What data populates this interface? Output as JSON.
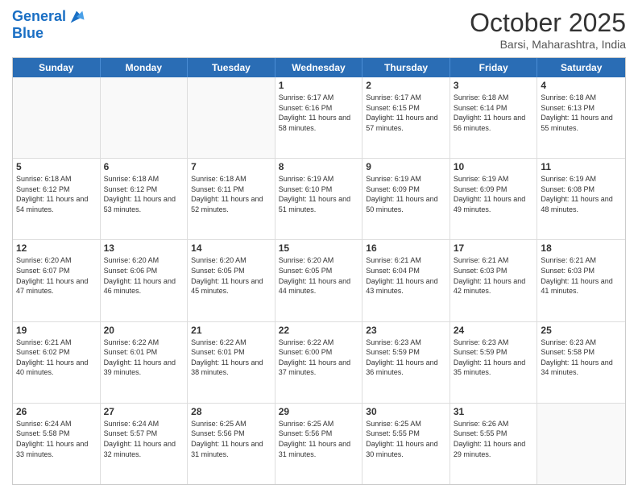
{
  "header": {
    "logo_line1": "General",
    "logo_line2": "Blue",
    "month": "October 2025",
    "location": "Barsi, Maharashtra, India"
  },
  "days_of_week": [
    "Sunday",
    "Monday",
    "Tuesday",
    "Wednesday",
    "Thursday",
    "Friday",
    "Saturday"
  ],
  "weeks": [
    [
      {
        "day": "",
        "info": ""
      },
      {
        "day": "",
        "info": ""
      },
      {
        "day": "",
        "info": ""
      },
      {
        "day": "1",
        "info": "Sunrise: 6:17 AM\nSunset: 6:16 PM\nDaylight: 11 hours and 58 minutes."
      },
      {
        "day": "2",
        "info": "Sunrise: 6:17 AM\nSunset: 6:15 PM\nDaylight: 11 hours and 57 minutes."
      },
      {
        "day": "3",
        "info": "Sunrise: 6:18 AM\nSunset: 6:14 PM\nDaylight: 11 hours and 56 minutes."
      },
      {
        "day": "4",
        "info": "Sunrise: 6:18 AM\nSunset: 6:13 PM\nDaylight: 11 hours and 55 minutes."
      }
    ],
    [
      {
        "day": "5",
        "info": "Sunrise: 6:18 AM\nSunset: 6:12 PM\nDaylight: 11 hours and 54 minutes."
      },
      {
        "day": "6",
        "info": "Sunrise: 6:18 AM\nSunset: 6:12 PM\nDaylight: 11 hours and 53 minutes."
      },
      {
        "day": "7",
        "info": "Sunrise: 6:18 AM\nSunset: 6:11 PM\nDaylight: 11 hours and 52 minutes."
      },
      {
        "day": "8",
        "info": "Sunrise: 6:19 AM\nSunset: 6:10 PM\nDaylight: 11 hours and 51 minutes."
      },
      {
        "day": "9",
        "info": "Sunrise: 6:19 AM\nSunset: 6:09 PM\nDaylight: 11 hours and 50 minutes."
      },
      {
        "day": "10",
        "info": "Sunrise: 6:19 AM\nSunset: 6:09 PM\nDaylight: 11 hours and 49 minutes."
      },
      {
        "day": "11",
        "info": "Sunrise: 6:19 AM\nSunset: 6:08 PM\nDaylight: 11 hours and 48 minutes."
      }
    ],
    [
      {
        "day": "12",
        "info": "Sunrise: 6:20 AM\nSunset: 6:07 PM\nDaylight: 11 hours and 47 minutes."
      },
      {
        "day": "13",
        "info": "Sunrise: 6:20 AM\nSunset: 6:06 PM\nDaylight: 11 hours and 46 minutes."
      },
      {
        "day": "14",
        "info": "Sunrise: 6:20 AM\nSunset: 6:05 PM\nDaylight: 11 hours and 45 minutes."
      },
      {
        "day": "15",
        "info": "Sunrise: 6:20 AM\nSunset: 6:05 PM\nDaylight: 11 hours and 44 minutes."
      },
      {
        "day": "16",
        "info": "Sunrise: 6:21 AM\nSunset: 6:04 PM\nDaylight: 11 hours and 43 minutes."
      },
      {
        "day": "17",
        "info": "Sunrise: 6:21 AM\nSunset: 6:03 PM\nDaylight: 11 hours and 42 minutes."
      },
      {
        "day": "18",
        "info": "Sunrise: 6:21 AM\nSunset: 6:03 PM\nDaylight: 11 hours and 41 minutes."
      }
    ],
    [
      {
        "day": "19",
        "info": "Sunrise: 6:21 AM\nSunset: 6:02 PM\nDaylight: 11 hours and 40 minutes."
      },
      {
        "day": "20",
        "info": "Sunrise: 6:22 AM\nSunset: 6:01 PM\nDaylight: 11 hours and 39 minutes."
      },
      {
        "day": "21",
        "info": "Sunrise: 6:22 AM\nSunset: 6:01 PM\nDaylight: 11 hours and 38 minutes."
      },
      {
        "day": "22",
        "info": "Sunrise: 6:22 AM\nSunset: 6:00 PM\nDaylight: 11 hours and 37 minutes."
      },
      {
        "day": "23",
        "info": "Sunrise: 6:23 AM\nSunset: 5:59 PM\nDaylight: 11 hours and 36 minutes."
      },
      {
        "day": "24",
        "info": "Sunrise: 6:23 AM\nSunset: 5:59 PM\nDaylight: 11 hours and 35 minutes."
      },
      {
        "day": "25",
        "info": "Sunrise: 6:23 AM\nSunset: 5:58 PM\nDaylight: 11 hours and 34 minutes."
      }
    ],
    [
      {
        "day": "26",
        "info": "Sunrise: 6:24 AM\nSunset: 5:58 PM\nDaylight: 11 hours and 33 minutes."
      },
      {
        "day": "27",
        "info": "Sunrise: 6:24 AM\nSunset: 5:57 PM\nDaylight: 11 hours and 32 minutes."
      },
      {
        "day": "28",
        "info": "Sunrise: 6:25 AM\nSunset: 5:56 PM\nDaylight: 11 hours and 31 minutes."
      },
      {
        "day": "29",
        "info": "Sunrise: 6:25 AM\nSunset: 5:56 PM\nDaylight: 11 hours and 31 minutes."
      },
      {
        "day": "30",
        "info": "Sunrise: 6:25 AM\nSunset: 5:55 PM\nDaylight: 11 hours and 30 minutes."
      },
      {
        "day": "31",
        "info": "Sunrise: 6:26 AM\nSunset: 5:55 PM\nDaylight: 11 hours and 29 minutes."
      },
      {
        "day": "",
        "info": ""
      }
    ]
  ]
}
